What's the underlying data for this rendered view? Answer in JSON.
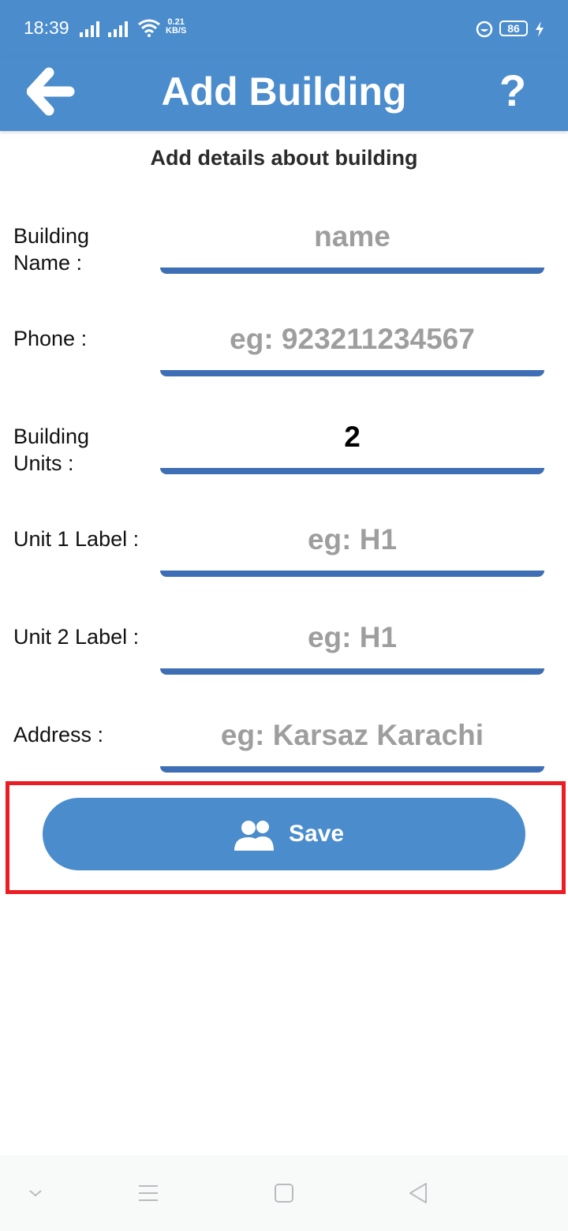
{
  "status_bar": {
    "time": "18:39",
    "net_speed_value": "0.21",
    "net_speed_unit": "KB/S",
    "battery": "86"
  },
  "app_bar": {
    "title": "Add Building",
    "help_label": "?",
    "back_icon": "arrow-left-icon"
  },
  "form": {
    "subtitle": "Add details about building",
    "fields": [
      {
        "label": "Building\nName :",
        "value": "",
        "placeholder": "name"
      },
      {
        "label": "Phone :",
        "value": "",
        "placeholder": "eg: 923211234567"
      },
      {
        "label": "Building\nUnits :",
        "value": "2",
        "placeholder": ""
      },
      {
        "label": "Unit 1 Label :",
        "value": "",
        "placeholder": "eg: H1"
      },
      {
        "label": "Unit 2 Label :",
        "value": "",
        "placeholder": "eg: H1"
      },
      {
        "label": "Address :",
        "value": "",
        "placeholder": "eg: Karsaz Karachi"
      }
    ]
  },
  "save_button": {
    "label": "Save",
    "icon": "people-icon"
  },
  "colors": {
    "primary": "#4a8ccc",
    "underline": "#3e6fb4",
    "highlight": "#ec1c24",
    "placeholder": "#9e9e9e"
  }
}
